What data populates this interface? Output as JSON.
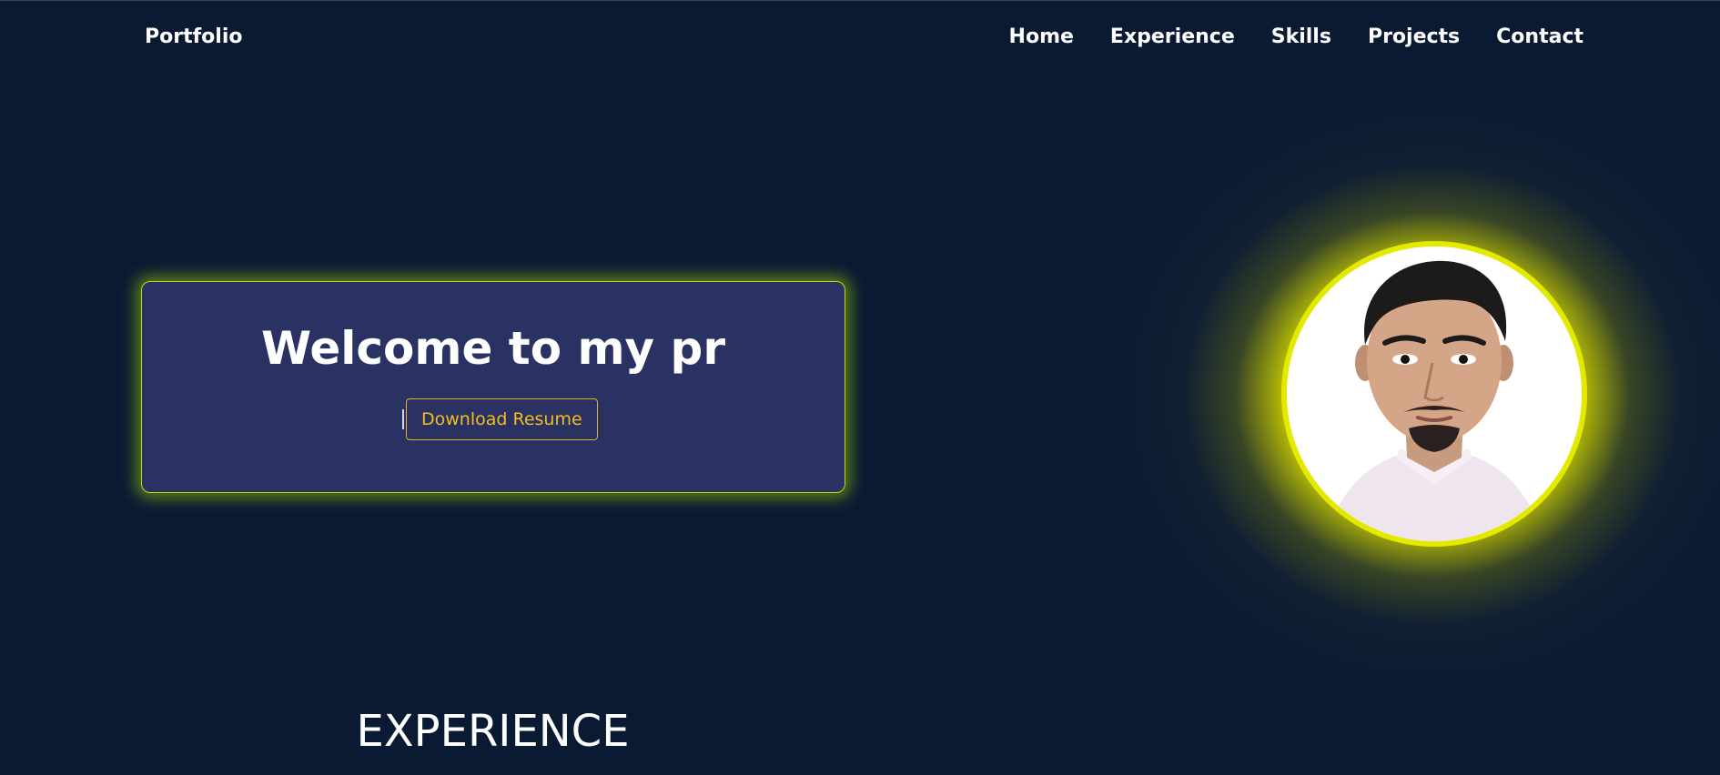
{
  "nav": {
    "brand": "Portfolio",
    "links": [
      "Home",
      "Experience",
      "Skills",
      "Projects",
      "Contact"
    ]
  },
  "hero": {
    "title": "Welcome to my pr",
    "download_label": "Download Resume"
  },
  "profile_photo": {
    "alt": "Profile photo"
  },
  "sections": {
    "experience_heading": "EXPERIENCE"
  },
  "colors": {
    "background": "#0b1a33",
    "card": "#2a3163",
    "glow": "#e3ea00",
    "button_text": "#f5bd1f"
  }
}
